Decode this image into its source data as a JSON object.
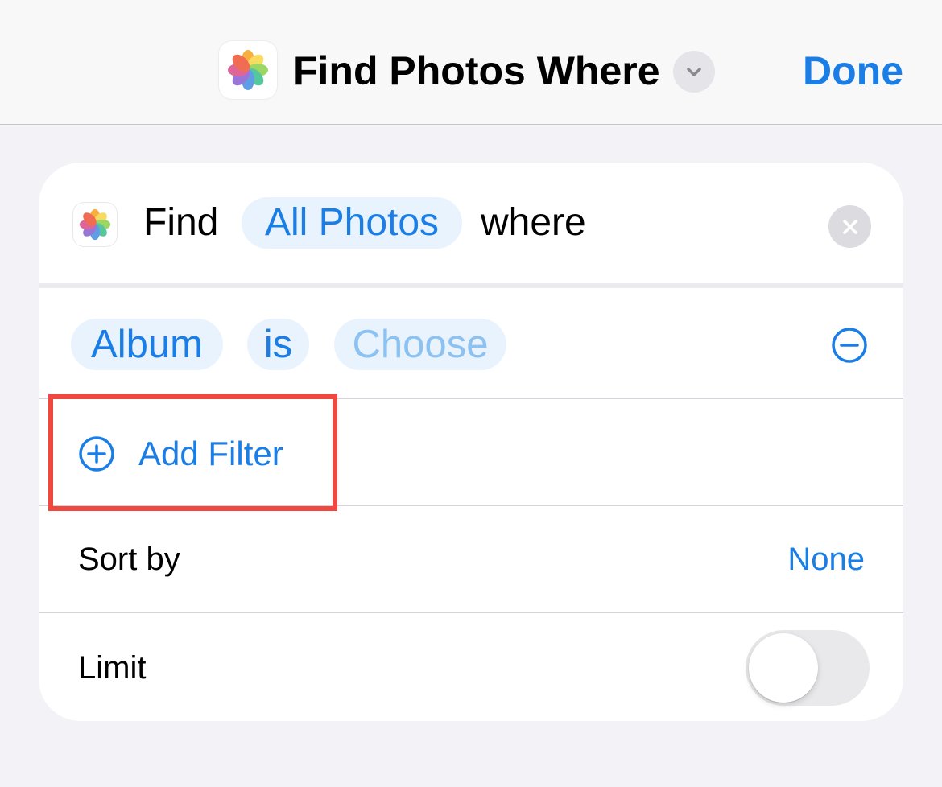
{
  "navbar": {
    "app_icon": "photos-flower-icon",
    "title": "Find Photos Where",
    "chevron_icon": "chevron-down-icon",
    "done_label": "Done"
  },
  "action": {
    "app_icon": "photos-flower-icon",
    "word_find": "Find",
    "source_pill": "All Photos",
    "word_where": "where",
    "close_icon": "close-icon"
  },
  "filter": {
    "property": "Album",
    "operator": "is",
    "value_placeholder": "Choose",
    "remove_icon": "minus-circle-icon"
  },
  "add_filter": {
    "icon": "plus-circle-icon",
    "label": "Add Filter"
  },
  "sort": {
    "label": "Sort by",
    "value": "None"
  },
  "limit": {
    "label": "Limit",
    "enabled": false
  },
  "colors": {
    "accent": "#1a7ee6",
    "pill_background": "#e9f3fd",
    "highlight": "#f0483e",
    "background": "#f2f2f7"
  }
}
